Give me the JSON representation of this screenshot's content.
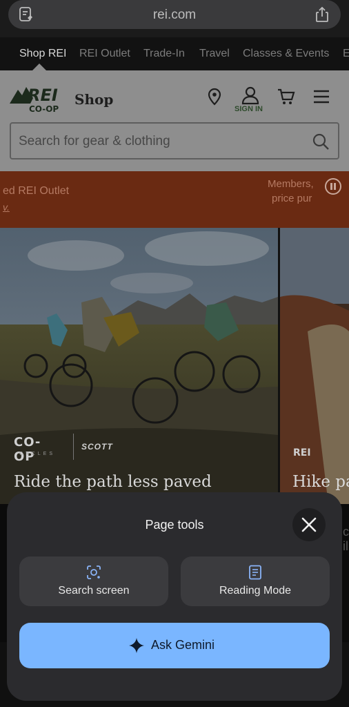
{
  "browser": {
    "url": "rei.com"
  },
  "topnav": {
    "items": [
      "Shop REI",
      "REI Outlet",
      "Trade-In",
      "Travel",
      "Classes & Events",
      "E"
    ]
  },
  "header": {
    "logo_top": "REI",
    "logo_bottom": "CO-OP",
    "shop_label": "Shop",
    "sign_in_label": "SIGN IN",
    "search_placeholder": "Search for gear & clothing"
  },
  "banner": {
    "left_line1": "ed REI Outlet",
    "left_line2": "v.",
    "right_line1": "Members,",
    "right_line2": "price pur"
  },
  "hero": {
    "slide1_brand1": "CO-OP",
    "slide1_brand1_sub": "CYCLES",
    "slide1_brand2": "SCOTT",
    "slide1_title": "Ride the path less paved",
    "slide2_logo": "REI",
    "slide2_title": "Hike pa"
  },
  "page_tools": {
    "title": "Page tools",
    "search_screen_label": "Search screen",
    "reading_mode_label": "Reading Mode",
    "ask_gemini_label": "Ask Gemini"
  },
  "peek": {
    "line1": "c",
    "line2": "il"
  },
  "colors": {
    "gemini_button": "#7ab6ff",
    "sheet_bg": "#2b2b2e",
    "banner": "#6a2a12"
  }
}
